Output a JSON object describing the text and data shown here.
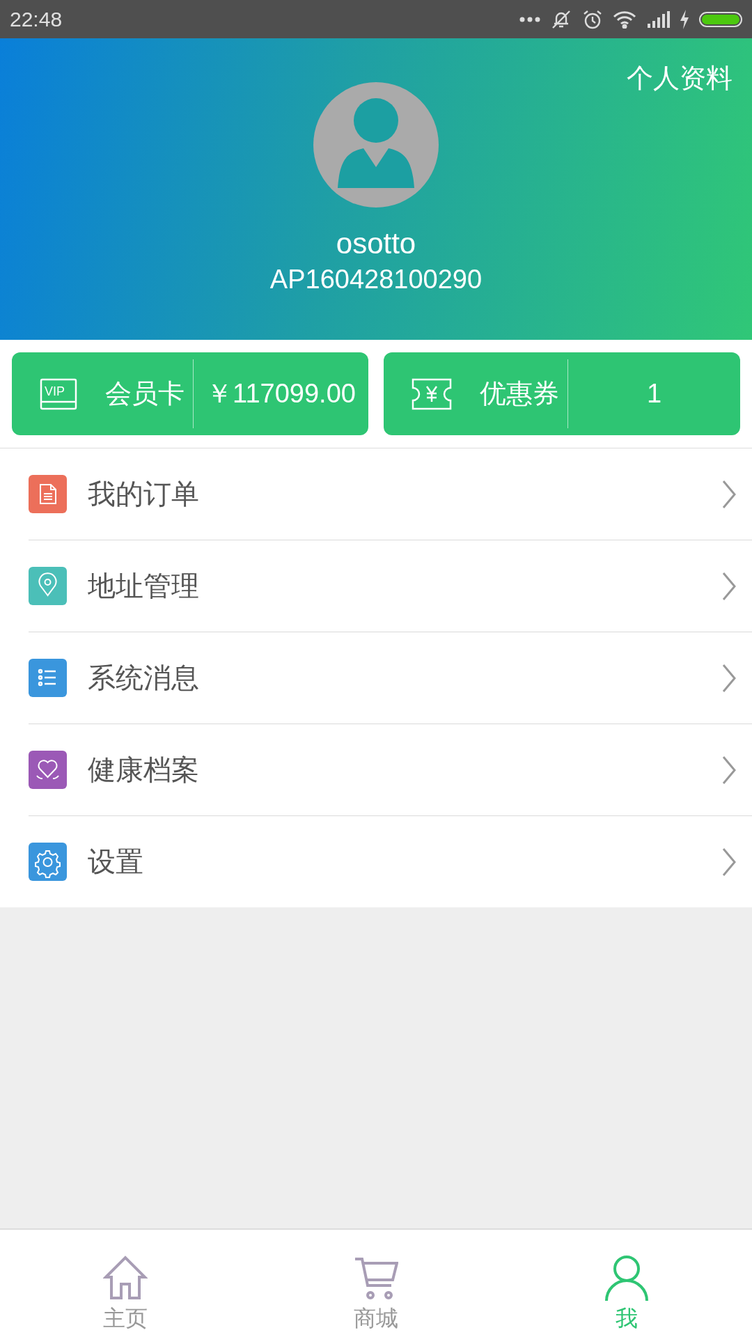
{
  "status_bar": {
    "time": "22:48"
  },
  "header": {
    "profile_link": "个人资料",
    "username": "osotto",
    "member_id": "AP160428100290"
  },
  "cards": [
    {
      "kind": "vip",
      "icon_text": "VIP",
      "label": "会员卡",
      "value": "￥117099.00"
    },
    {
      "kind": "coupon",
      "label": "优惠券",
      "value": "1"
    }
  ],
  "menu": [
    {
      "kind": "order",
      "label": "我的订单",
      "color": "#ec6f5a"
    },
    {
      "kind": "address",
      "label": "地址管理",
      "color": "#4bbfb8"
    },
    {
      "kind": "message",
      "label": "系统消息",
      "color": "#3a96dd"
    },
    {
      "kind": "health",
      "label": "健康档案",
      "color": "#9b59b6"
    },
    {
      "kind": "settings",
      "label": "设置",
      "color": "#3a96dd"
    }
  ],
  "tabs": [
    {
      "kind": "home",
      "label": "主页",
      "selected": false
    },
    {
      "kind": "shop",
      "label": "商城",
      "selected": false
    },
    {
      "kind": "me",
      "label": "我",
      "selected": true
    }
  ]
}
